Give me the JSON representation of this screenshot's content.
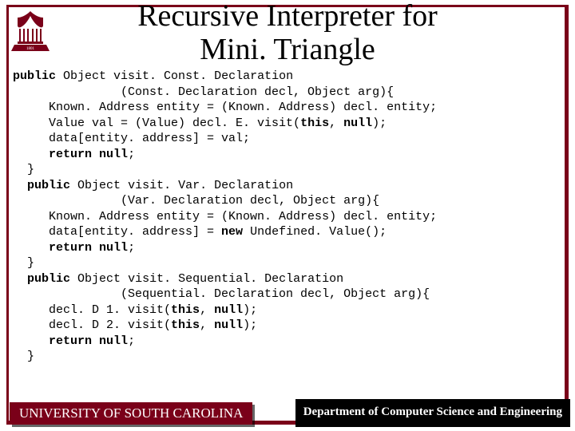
{
  "title": {
    "line1": "Recursive Interpreter for",
    "line2": "Mini. Triangle"
  },
  "code": {
    "k_public": "public",
    "k_return": "return",
    "k_null": "null",
    "k_this": "this",
    "k_new": "new",
    "t_object": "Object",
    "m1_sig_a": " visit. Const. Declaration",
    "m1_sig_b": "               (Const. Declaration decl, Object arg){",
    "m1_l1": "     Known. Address entity = (Known. Address) decl. entity;",
    "m1_l2": "     Value val = (Value) decl. E. visit(",
    "m1_l2b": ");",
    "m1_l3": "     data[entity. address] = val;",
    "m1_ret": "     ",
    "semicolon": ";",
    "close": "  }",
    "m2_sig_a": " visit. Var. Declaration",
    "m2_sig_b": "               (Var. Declaration decl, Object arg){",
    "m2_l1": "     Known. Address entity = (Known. Address) decl. entity;",
    "m2_l2a": "     data[entity. address] = ",
    "m2_l2b": " Undefined. Value();",
    "m3_sig_a": " visit. Sequential. Declaration",
    "m3_sig_b": "               (Sequential. Declaration decl, Object arg){",
    "m3_l1": "     decl. D 1. visit(",
    "m3_l2": "     decl. D 2. visit(",
    "comma_sp": ", "
  },
  "footer": {
    "left": "UNIVERSITY OF SOUTH CAROLINA",
    "right": "Department of Computer Science and Engineering"
  },
  "logo": {
    "name": "usc-seal-logo",
    "color": "#7a0019"
  }
}
